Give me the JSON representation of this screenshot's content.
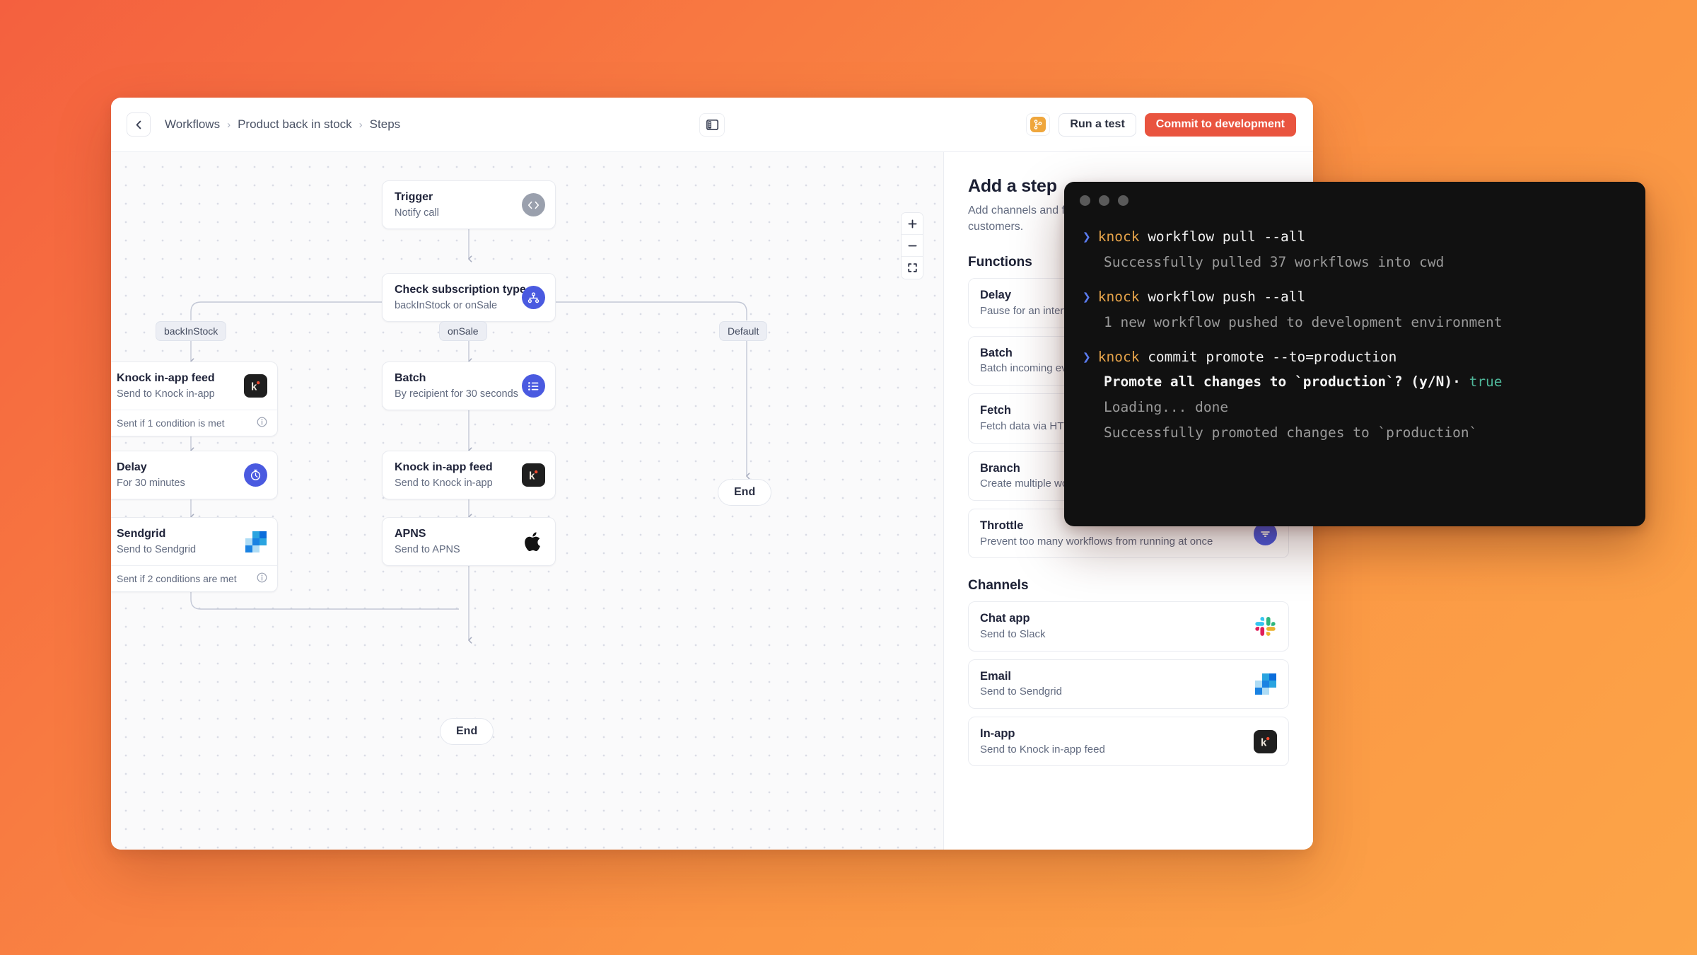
{
  "topbar": {
    "back_icon": "chevron-left-icon",
    "breadcrumb": [
      "Workflows",
      "Product back in stock",
      "Steps"
    ],
    "separator": "›",
    "panel_toggle_icon": "panel-layout-icon",
    "branch_icon": "git-branch-icon",
    "run_test_label": "Run a test",
    "commit_label": "Commit to development",
    "commit_color": "#e9543f",
    "branch_color": "#efa63c"
  },
  "canvas": {
    "zoom_controls": {
      "zoom_in": "+",
      "zoom_out": "−",
      "fit": "fit-screen-icon"
    },
    "nodes": [
      {
        "title": "Trigger",
        "sub": "Notify call",
        "icon": "code-icon",
        "icon_color": "#9aa0ad"
      },
      {
        "title": "Check subscription type",
        "sub": "backInStock or onSale",
        "icon": "branch-icon",
        "icon_color": "#4a5ae0"
      },
      {
        "title": "Knock in-app feed",
        "sub": "Send to Knock in-app",
        "icon": "knock-logo-icon",
        "footer": "Sent if 1 condition is met",
        "footer_icon": "info-icon"
      },
      {
        "title": "Delay",
        "sub": "For 30 minutes",
        "icon": "stopwatch-icon",
        "icon_color": "#4a5ae0"
      },
      {
        "title": "Sendgrid",
        "sub": "Send to Sendgrid",
        "icon": "sendgrid-logo-icon",
        "footer": "Sent if 2 conditions are met",
        "footer_icon": "info-icon"
      },
      {
        "title": "Batch",
        "sub": "By recipient for 30 seconds",
        "icon": "list-icon",
        "icon_color": "#4a5ae0"
      },
      {
        "title": "Knock in-app feed",
        "sub": "Send to Knock in-app",
        "icon": "knock-logo-icon"
      },
      {
        "title": "APNS",
        "sub": "Send to APNS",
        "icon": "apple-logo-icon"
      }
    ],
    "branch_labels": [
      "backInStock",
      "onSale",
      "Default"
    ],
    "end_labels": [
      "End",
      "End"
    ]
  },
  "side_panel": {
    "title": "Add a step",
    "description": "Add channels and functions to send messages to your customers.",
    "sections": [
      {
        "heading": "Functions",
        "items": [
          {
            "title": "Delay",
            "sub": "Pause for an interval of time",
            "icon": "stopwatch-icon"
          },
          {
            "title": "Batch",
            "sub": "Batch incoming events together",
            "icon": "list-icon"
          },
          {
            "title": "Fetch",
            "sub": "Fetch data via HTTP request",
            "icon": "fetch-icon"
          },
          {
            "title": "Branch",
            "sub": "Create multiple workflow paths",
            "icon": "branch-icon"
          },
          {
            "title": "Throttle",
            "sub": "Prevent too many workflows from running at once",
            "icon": "funnel-icon"
          }
        ]
      },
      {
        "heading": "Channels",
        "items": [
          {
            "title": "Chat app",
            "sub": "Send to Slack",
            "icon": "slack-logo-icon"
          },
          {
            "title": "Email",
            "sub": "Send to Sendgrid",
            "icon": "sendgrid-logo-icon"
          },
          {
            "title": "In-app",
            "sub": "Send to Knock in-app feed",
            "icon": "knock-logo-icon"
          }
        ]
      }
    ]
  },
  "terminal": {
    "traffic_lights": 3,
    "prompt": "❯",
    "blocks": [
      {
        "bin": "knock",
        "args": " workflow pull --all",
        "output": [
          "Successfully pulled 37 workflows into cwd"
        ]
      },
      {
        "bin": "knock",
        "args": " workflow push --all",
        "output": [
          "1 new workflow pushed to development environment"
        ]
      },
      {
        "bin": "knock",
        "args": " commit promote --to=production",
        "confirm_text": "Promote all changes to `production`? (y/N)·",
        "confirm_answer": "true",
        "output": [
          "Loading... done",
          "Successfully promoted changes to `production`"
        ]
      }
    ]
  }
}
